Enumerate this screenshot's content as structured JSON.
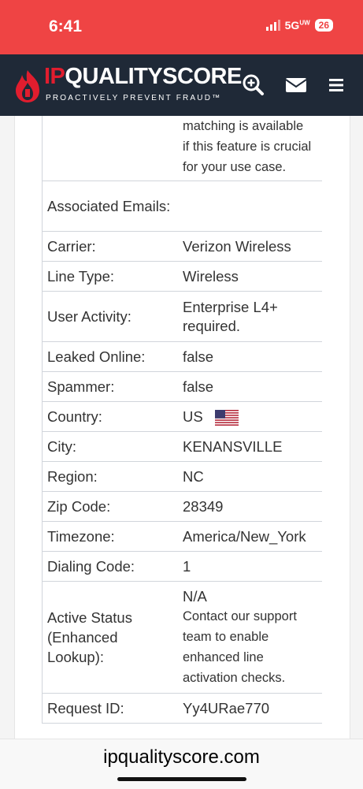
{
  "status_bar": {
    "time": "6:41",
    "network": "5G",
    "network_sup": "UW",
    "battery": "26"
  },
  "header": {
    "brand_prefix": "IP",
    "brand_rest": "QUALITYSCORE",
    "tagline": "PROACTIVELY PREVENT FRAUD™"
  },
  "partial_note": {
    "line1": "matching is available",
    "line2": "if this feature is crucial",
    "line3": "for your use case."
  },
  "rows": [
    {
      "label": "Associated Emails:",
      "value": ""
    },
    {
      "label": "Carrier:",
      "value": "Verizon Wireless"
    },
    {
      "label": "Line Type:",
      "value": "Wireless"
    },
    {
      "label": "User Activity:",
      "value": "Enterprise L4+ required."
    },
    {
      "label": "Leaked Online:",
      "value": "false"
    },
    {
      "label": "Spammer:",
      "value": "false"
    },
    {
      "label": "Country:",
      "value": "US"
    },
    {
      "label": "City:",
      "value": "KENANSVILLE"
    },
    {
      "label": "Region:",
      "value": "NC"
    },
    {
      "label": "Zip Code:",
      "value": "28349"
    },
    {
      "label": "Timezone:",
      "value": "America/New_York"
    },
    {
      "label": "Dialing Code:",
      "value": "1"
    },
    {
      "label": "Active Status (Enhanced Lookup):",
      "value": "N/A",
      "note": "Contact our support team to enable enhanced line activation checks."
    },
    {
      "label": "Request ID:",
      "value": "Yy4URae770"
    }
  ],
  "colors": {
    "status_bar": "#ef4444",
    "header": "#1f2937",
    "brand_red": "#e11d2e",
    "false_value": "#15803d"
  },
  "icons": {
    "search": "search-plus-icon",
    "mail": "mail-icon",
    "menu": "menu-icon",
    "flag": "us-flag-icon"
  },
  "footer": {
    "url": "ipqualityscore.com"
  }
}
